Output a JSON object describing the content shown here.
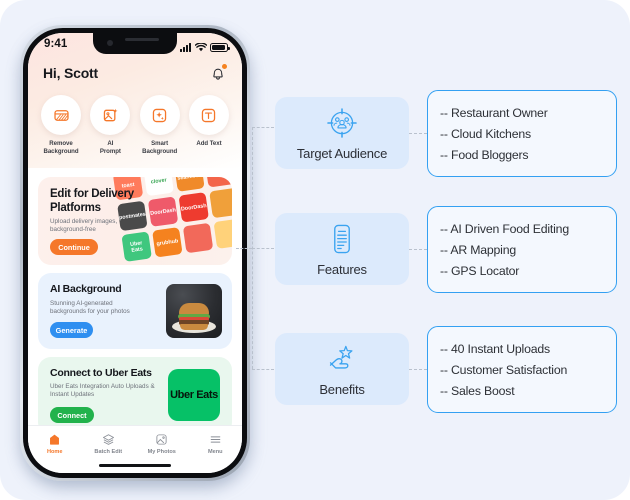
{
  "phone": {
    "status": {
      "time": "9:41",
      "icons": [
        "signal-icon",
        "wifi-icon",
        "battery-icon"
      ]
    },
    "greeting": "Hi, Scott",
    "notification_icon": "bell-icon",
    "quick_actions": [
      {
        "label": "Remove\nBackground",
        "icon": "eraser-icon"
      },
      {
        "label": "AI\nPrompt",
        "icon": "image-sparkle-icon"
      },
      {
        "label": "Smart\nBackground",
        "icon": "sparkle-box-icon"
      },
      {
        "label": "Add Text",
        "icon": "text-box-icon"
      }
    ],
    "cards": [
      {
        "title": "Edit for Delivery Platforms",
        "subtitle": "Upload delivery images, background-free",
        "button": "Continue",
        "button_color": "#f5772a",
        "tiles": [
          {
            "text": "toast",
            "color": "#ff7b5c"
          },
          {
            "text": "clover",
            "color": "#ffffff"
          },
          {
            "text": "seamless",
            "color": "#f08a2a"
          },
          {
            "text": "postmates",
            "color": "#4a4a4a"
          },
          {
            "text": "DoorDash",
            "color": "#ef5a6a"
          },
          {
            "text": "DoorDash",
            "color": "#ee3b2f"
          },
          {
            "text": "Uber Eats",
            "color": "#3fc77e"
          },
          {
            "text": "grubhub",
            "color": "#f5821f"
          }
        ]
      },
      {
        "title": "AI Background",
        "subtitle": "Stunning AI-generated backgrounds for your photos",
        "button": "Generate",
        "button_color": "#2f8ff0",
        "image": "burger-photo"
      },
      {
        "title": "Connect to Uber Eats",
        "subtitle": "Uber Eats Integration Auto Uploads & Instant Updates",
        "button": "Connect",
        "button_color": "#22b24c",
        "logo": "Uber Eats"
      }
    ],
    "tabs": [
      {
        "label": "Home",
        "icon": "home-icon",
        "active": true
      },
      {
        "label": "Batch Edit",
        "icon": "layers-icon",
        "active": false
      },
      {
        "label": "My Photos",
        "icon": "photo-icon",
        "active": false
      },
      {
        "label": "Menu",
        "icon": "hamburger-icon",
        "active": false
      }
    ]
  },
  "diagram": {
    "accent_border": "#33a0f2",
    "node_bg": "#dceafc",
    "groups": [
      {
        "label": "Target Audience",
        "icon": "target-audience-icon",
        "items": [
          "-- Restaurant Owner",
          "-- Cloud Kitchens",
          "-- Food Bloggers"
        ]
      },
      {
        "label": "Features",
        "icon": "document-list-icon",
        "items": [
          "-- AI Driven Food Editing",
          "-- AR Mapping",
          "-- GPS Locator"
        ]
      },
      {
        "label": "Benefits",
        "icon": "hand-star-icon",
        "items": [
          "-- 40 Instant Uploads",
          "-- Customer Satisfaction",
          "-- Sales Boost"
        ]
      }
    ]
  }
}
